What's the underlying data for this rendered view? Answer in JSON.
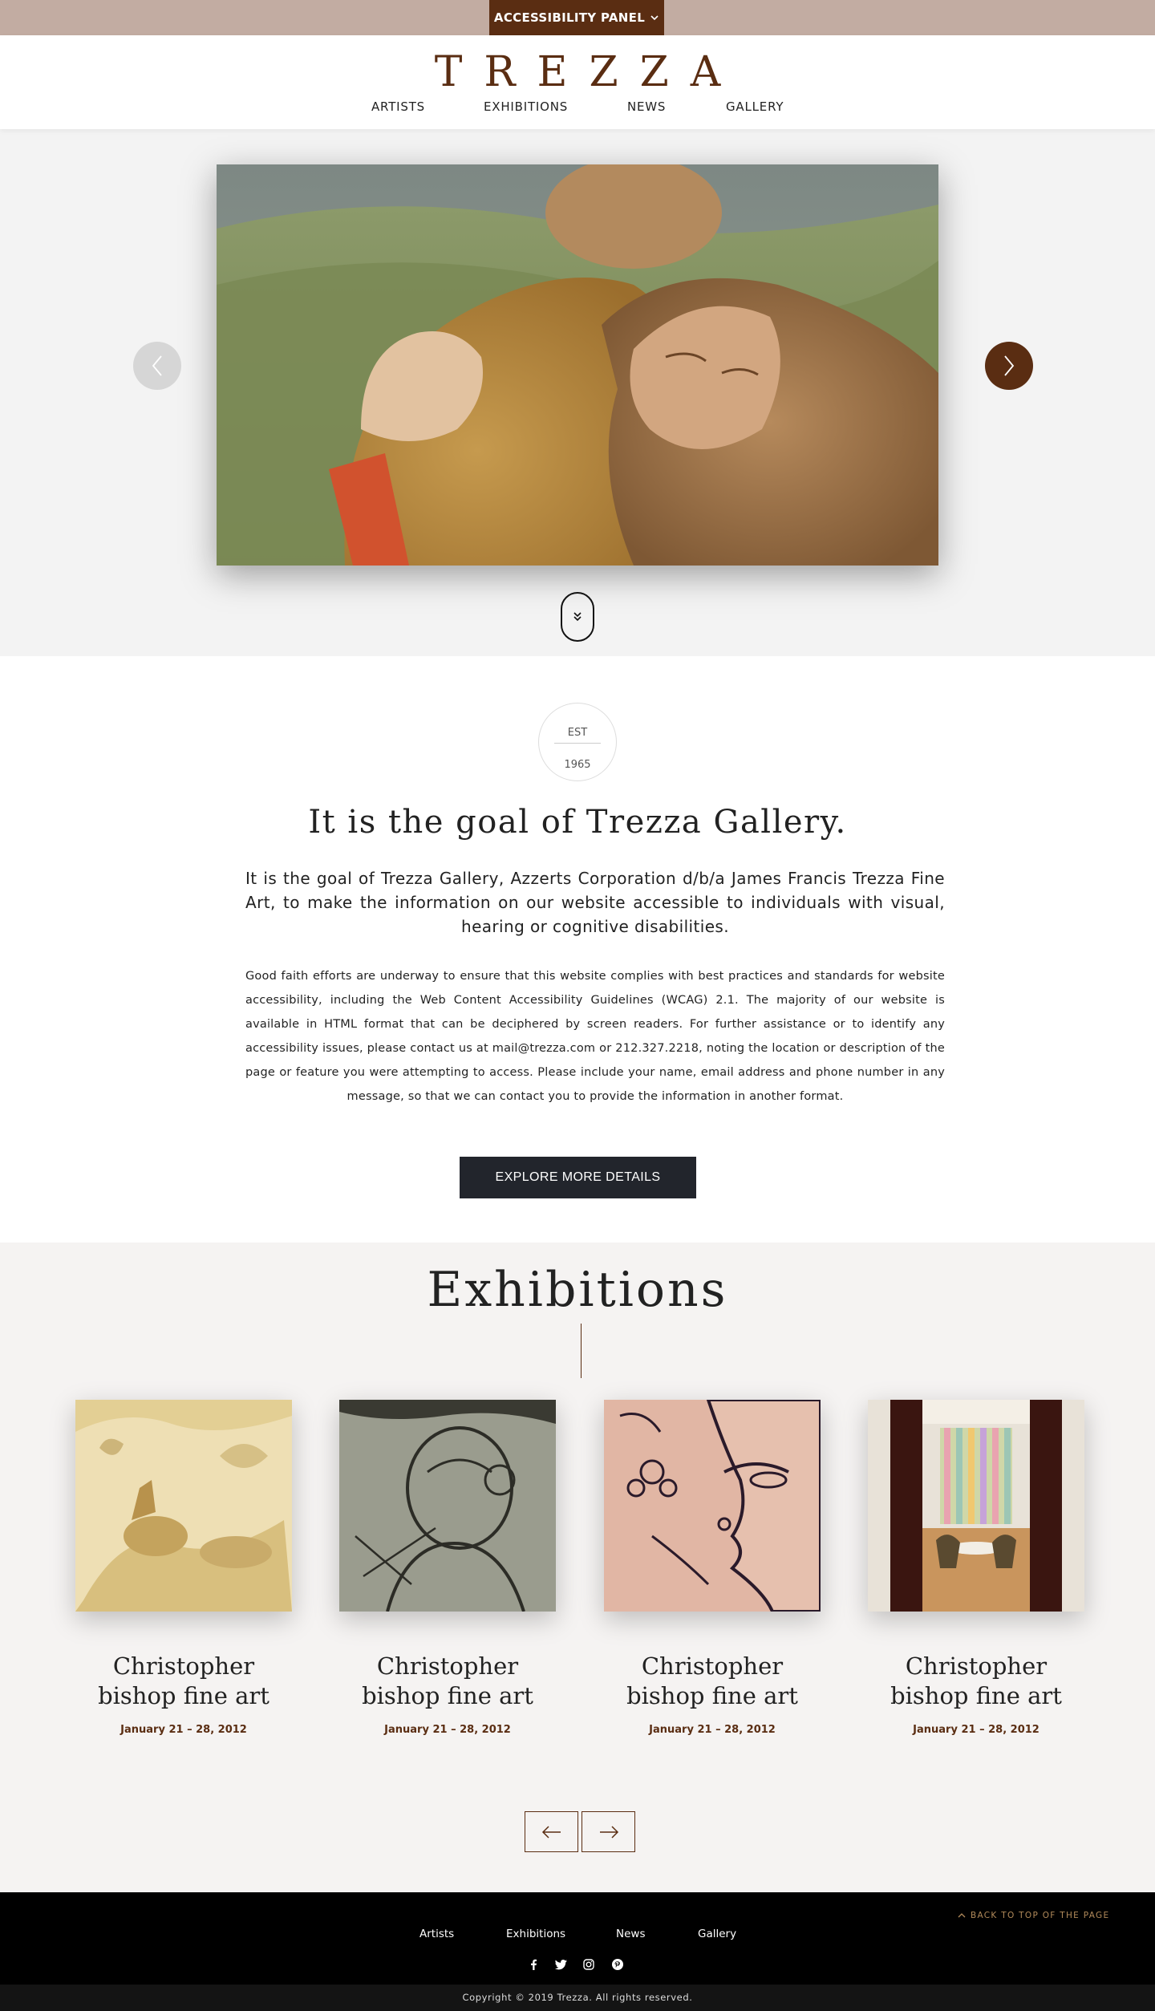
{
  "accessibility": {
    "label": "ACCESSIBILITY PANEL"
  },
  "header": {
    "logo": "TREZZA",
    "nav": [
      "ARTISTS",
      "EXHIBITIONS",
      "NEWS",
      "GALLERY"
    ]
  },
  "hero": {
    "prev_icon": "chevron-left-icon",
    "next_icon": "chevron-right-icon",
    "scroll_icon": "double-chevron-down-icon"
  },
  "intro": {
    "est_label": "EST",
    "est_year": "1965",
    "title": "It is the goal of Trezza Gallery.",
    "lead": "It is the goal of Trezza Gallery, Azzerts Corporation d/b/a James Francis Trezza Fine Art, to make the information on our website accessible to individuals with visual, hearing or cognitive disabilities.",
    "body": "Good faith efforts are underway to ensure that this website complies with best practices and standards for website accessibility, including the Web Content Accessibility Guidelines (WCAG) 2.1. The majority of our website is available in HTML format that can be deciphered by screen readers. For further assistance or to identify any accessibility issues, please contact us at mail@trezza.com or 212.327.2218, noting the location or description of the page or feature you were attempting to access. Please include your name, email address and phone number in any message, so that we can contact you to provide the information in another format.",
    "button": "EXPLORE MORE DETAILS"
  },
  "exhibitions": {
    "heading": "Exhibitions",
    "cards": [
      {
        "title": "Christopher bishop fine art",
        "date": "January 21 – 28, 2012"
      },
      {
        "title": "Christopher bishop fine art",
        "date": "January 21 – 28, 2012"
      },
      {
        "title": "Christopher bishop fine art",
        "date": "January 21 – 28, 2012"
      },
      {
        "title": "Christopher bishop fine art",
        "date": "January 21 – 28, 2012"
      }
    ],
    "prev_icon": "arrow-left-icon",
    "next_icon": "arrow-right-icon"
  },
  "footer": {
    "back_to_top": "BACK TO TOP OF THE PAGE",
    "nav": [
      "Artists",
      "Exhibitions",
      "News",
      "Gallery"
    ],
    "social": [
      "facebook-icon",
      "twitter-icon",
      "instagram-icon",
      "pinterest-icon"
    ],
    "copyright": "Copyright © 2019 Trezza. All rights reserved."
  },
  "colors": {
    "brand": "#5a2d12",
    "topbar": "#c2aca2",
    "button_dark": "#22252c",
    "footer": "#000000"
  }
}
